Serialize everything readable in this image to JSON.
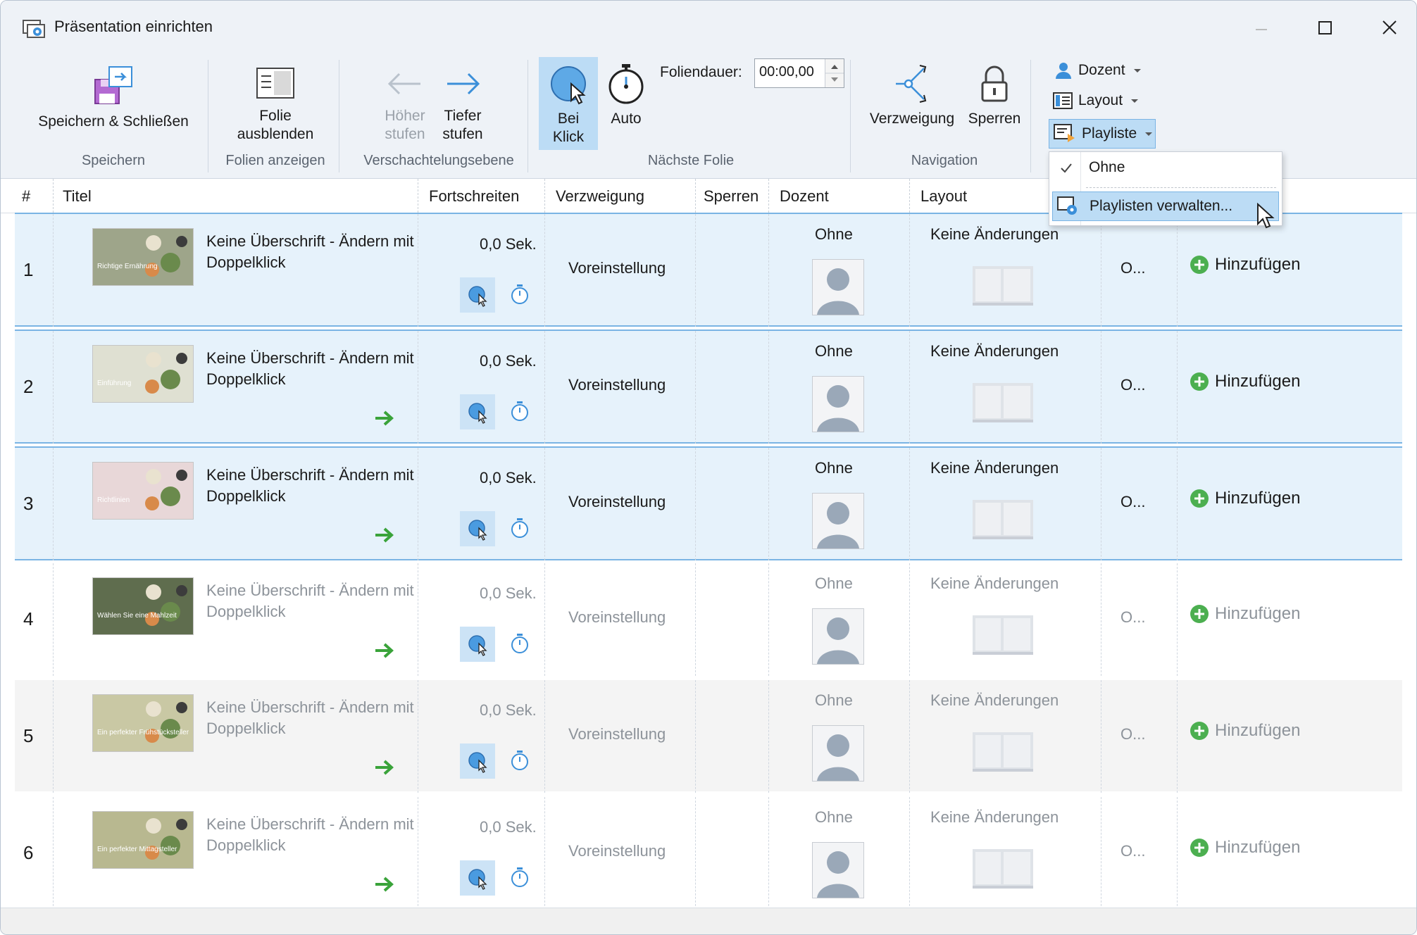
{
  "window": {
    "title": "Präsentation einrichten"
  },
  "ribbon": {
    "save_close": "Speichern & Schließen",
    "group_speichern": "Speichern",
    "folie_ausblenden_1": "Folie",
    "folie_ausblenden_2": "ausblenden",
    "group_folien_anzeigen": "Folien anzeigen",
    "hoeher_1": "Höher",
    "hoeher_2": "stufen",
    "tiefer_1": "Tiefer",
    "tiefer_2": "stufen",
    "group_verschachtelung": "Verschachtelungsebene",
    "bei_klick_1": "Bei",
    "bei_klick_2": "Klick",
    "auto": "Auto",
    "foliendauer_label": "Foliendauer:",
    "foliendauer_value": "00:00,00",
    "group_naechste_folie": "Nächste Folie",
    "verzweigung": "Verzweigung",
    "sperren": "Sperren",
    "group_navigation": "Navigation",
    "dozent": "Dozent",
    "layout": "Layout",
    "playliste": "Playliste"
  },
  "dropdown": {
    "ohne": "Ohne",
    "verwalten": "Playlisten verwalten..."
  },
  "table": {
    "headers": {
      "num": "#",
      "titel": "Titel",
      "fortschreiten": "Fortschreiten",
      "verzweigung": "Verzweigung",
      "sperren": "Sperren",
      "dozent": "Dozent",
      "layout": "Layout"
    },
    "rows": [
      {
        "num": "1",
        "title": "Keine Überschrift - Ändern mit Doppelklick",
        "dauer": "0,0 Sek.",
        "verzweigung": "Voreinstellung",
        "dozent": "Ohne",
        "layout": "Keine Änderungen",
        "playlist": "O...",
        "add": "Hinzufügen",
        "thumb_text": "Richtige Ernährung"
      },
      {
        "num": "2",
        "title": "Keine Überschrift - Ändern mit Doppelklick",
        "dauer": "0,0 Sek.",
        "verzweigung": "Voreinstellung",
        "dozent": "Ohne",
        "layout": "Keine Änderungen",
        "playlist": "O...",
        "add": "Hinzufügen",
        "thumb_text": "Einführung"
      },
      {
        "num": "3",
        "title": "Keine Überschrift - Ändern mit Doppelklick",
        "dauer": "0,0 Sek.",
        "verzweigung": "Voreinstellung",
        "dozent": "Ohne",
        "layout": "Keine Änderungen",
        "playlist": "O...",
        "add": "Hinzufügen",
        "thumb_text": "Richtlinien"
      },
      {
        "num": "4",
        "title": "Keine Überschrift - Ändern mit Doppelklick",
        "dauer": "0,0 Sek.",
        "verzweigung": "Voreinstellung",
        "dozent": "Ohne",
        "layout": "Keine Änderungen",
        "playlist": "O...",
        "add": "Hinzufügen",
        "thumb_text": "Wählen Sie eine Mahlzeit"
      },
      {
        "num": "5",
        "title": "Keine Überschrift - Ändern mit Doppelklick",
        "dauer": "0,0 Sek.",
        "verzweigung": "Voreinstellung",
        "dozent": "Ohne",
        "layout": "Keine Änderungen",
        "playlist": "O...",
        "add": "Hinzufügen",
        "thumb_text": "Ein perfekter Frühstücksteller"
      },
      {
        "num": "6",
        "title": "Keine Überschrift - Ändern mit Doppelklick",
        "dauer": "0,0 Sek.",
        "verzweigung": "Voreinstellung",
        "dozent": "Ohne",
        "layout": "Keine Änderungen",
        "playlist": "O...",
        "add": "Hinzufügen",
        "thumb_text": "Ein perfekter Mittagsteller"
      }
    ]
  },
  "colors": {
    "accent": "#3b8fd9",
    "selected_row": "#e6f2fb",
    "add_green": "#4caf50",
    "arrow_green": "#3aa33a"
  }
}
